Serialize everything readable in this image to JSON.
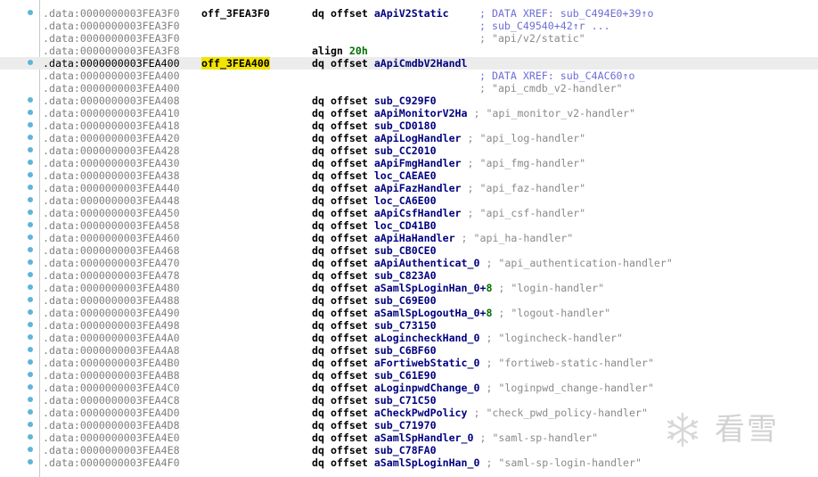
{
  "rows": [
    {
      "addr": ".data:0000000003FEA3F0",
      "label": "off_3FEA3F0",
      "mn": "dq offset",
      "op": "aApiV2Static",
      "cmt": "",
      "xref": "; DATA XREF: sub_C494E0+39↑o",
      "dot": true
    },
    {
      "addr": ".data:0000000003FEA3F0",
      "label": "",
      "mn": "",
      "op": "",
      "cmt": "",
      "xref": "; sub_C49540+42↑r ...",
      "dot": false
    },
    {
      "addr": ".data:0000000003FEA3F0",
      "label": "",
      "mn": "",
      "op": "",
      "cmt": "",
      "xref": "",
      "rcmt": "; \"api/v2/static\"",
      "dot": false
    },
    {
      "addr": ".data:0000000003FEA3F8",
      "label": "",
      "mn": "align",
      "op": "",
      "num": "20h",
      "cmt": "",
      "xref": "",
      "dot": false
    },
    {
      "addr": ".data:0000000003FEA400",
      "label": "off_3FEA400",
      "mn": "dq offset",
      "op": "aApiCmdbV2Handl",
      "cmt": "",
      "xref": "",
      "dot": true,
      "highlight": true
    },
    {
      "addr": ".data:0000000003FEA400",
      "label": "",
      "mn": "",
      "op": "",
      "cmt": "",
      "xref": "; DATA XREF: sub_C4AC60↑o",
      "dot": false
    },
    {
      "addr": ".data:0000000003FEA400",
      "label": "",
      "mn": "",
      "op": "",
      "cmt": "",
      "xref": "",
      "rcmt": "; \"api_cmdb_v2-handler\"",
      "dot": false
    },
    {
      "addr": ".data:0000000003FEA408",
      "label": "",
      "mn": "dq offset",
      "op": "sub_C929F0",
      "cmt": "",
      "xref": "",
      "dot": true
    },
    {
      "addr": ".data:0000000003FEA410",
      "label": "",
      "mn": "dq offset",
      "op": "aApiMonitorV2Ha",
      "cmt": " ; \"api_monitor_v2-handler\"",
      "xref": "",
      "dot": true
    },
    {
      "addr": ".data:0000000003FEA418",
      "label": "",
      "mn": "dq offset",
      "op": "sub_CD0180",
      "cmt": "",
      "xref": "",
      "dot": true
    },
    {
      "addr": ".data:0000000003FEA420",
      "label": "",
      "mn": "dq offset",
      "op": "aApiLogHandler",
      "cmt": " ; \"api_log-handler\"",
      "xref": "",
      "dot": true
    },
    {
      "addr": ".data:0000000003FEA428",
      "label": "",
      "mn": "dq offset",
      "op": "sub_CC2010",
      "cmt": "",
      "xref": "",
      "dot": true
    },
    {
      "addr": ".data:0000000003FEA430",
      "label": "",
      "mn": "dq offset",
      "op": "aApiFmgHandler",
      "cmt": " ; \"api_fmg-handler\"",
      "xref": "",
      "dot": true
    },
    {
      "addr": ".data:0000000003FEA438",
      "label": "",
      "mn": "dq offset",
      "op": "loc_CAEAE0",
      "cmt": "",
      "xref": "",
      "dot": true
    },
    {
      "addr": ".data:0000000003FEA440",
      "label": "",
      "mn": "dq offset",
      "op": "aApiFazHandler",
      "cmt": " ; \"api_faz-handler\"",
      "xref": "",
      "dot": true
    },
    {
      "addr": ".data:0000000003FEA448",
      "label": "",
      "mn": "dq offset",
      "op": "loc_CA6E00",
      "cmt": "",
      "xref": "",
      "dot": true
    },
    {
      "addr": ".data:0000000003FEA450",
      "label": "",
      "mn": "dq offset",
      "op": "aApiCsfHandler",
      "cmt": " ; \"api_csf-handler\"",
      "xref": "",
      "dot": true
    },
    {
      "addr": ".data:0000000003FEA458",
      "label": "",
      "mn": "dq offset",
      "op": "loc_CD41B0",
      "cmt": "",
      "xref": "",
      "dot": true
    },
    {
      "addr": ".data:0000000003FEA460",
      "label": "",
      "mn": "dq offset",
      "op": "aApiHaHandler",
      "cmt": " ; \"api_ha-handler\"",
      "xref": "",
      "dot": true
    },
    {
      "addr": ".data:0000000003FEA468",
      "label": "",
      "mn": "dq offset",
      "op": "sub_CB0CE0",
      "cmt": "",
      "xref": "",
      "dot": true
    },
    {
      "addr": ".data:0000000003FEA470",
      "label": "",
      "mn": "dq offset",
      "op": "aApiAuthenticat_0",
      "cmt": " ; \"api_authentication-handler\"",
      "xref": "",
      "dot": true
    },
    {
      "addr": ".data:0000000003FEA478",
      "label": "",
      "mn": "dq offset",
      "op": "sub_C823A0",
      "cmt": "",
      "xref": "",
      "dot": true
    },
    {
      "addr": ".data:0000000003FEA480",
      "label": "",
      "mn": "dq offset",
      "op": "aSamlSpLoginHan_0+",
      "num": "8",
      "cmt": " ; \"login-handler\"",
      "xref": "",
      "dot": true
    },
    {
      "addr": ".data:0000000003FEA488",
      "label": "",
      "mn": "dq offset",
      "op": "sub_C69E00",
      "cmt": "",
      "xref": "",
      "dot": true
    },
    {
      "addr": ".data:0000000003FEA490",
      "label": "",
      "mn": "dq offset",
      "op": "aSamlSpLogoutHa_0+",
      "num": "8",
      "cmt": " ; \"logout-handler\"",
      "xref": "",
      "dot": true
    },
    {
      "addr": ".data:0000000003FEA498",
      "label": "",
      "mn": "dq offset",
      "op": "sub_C73150",
      "cmt": "",
      "xref": "",
      "dot": true
    },
    {
      "addr": ".data:0000000003FEA4A0",
      "label": "",
      "mn": "dq offset",
      "op": "aLogincheckHand_0",
      "cmt": " ; \"logincheck-handler\"",
      "xref": "",
      "dot": true
    },
    {
      "addr": ".data:0000000003FEA4A8",
      "label": "",
      "mn": "dq offset",
      "op": "sub_C6BF60",
      "cmt": "",
      "xref": "",
      "dot": true
    },
    {
      "addr": ".data:0000000003FEA4B0",
      "label": "",
      "mn": "dq offset",
      "op": "aFortiwebStatic_0",
      "cmt": " ; \"fortiweb-static-handler\"",
      "xref": "",
      "dot": true
    },
    {
      "addr": ".data:0000000003FEA4B8",
      "label": "",
      "mn": "dq offset",
      "op": "sub_C61E90",
      "cmt": "",
      "xref": "",
      "dot": true
    },
    {
      "addr": ".data:0000000003FEA4C0",
      "label": "",
      "mn": "dq offset",
      "op": "aLoginpwdChange_0",
      "cmt": " ; \"loginpwd_change-handler\"",
      "xref": "",
      "dot": true
    },
    {
      "addr": ".data:0000000003FEA4C8",
      "label": "",
      "mn": "dq offset",
      "op": "sub_C71C50",
      "cmt": "",
      "xref": "",
      "dot": true
    },
    {
      "addr": ".data:0000000003FEA4D0",
      "label": "",
      "mn": "dq offset",
      "op": "aCheckPwdPolicy",
      "cmt": " ; \"check_pwd_policy-handler\"",
      "xref": "",
      "dot": true
    },
    {
      "addr": ".data:0000000003FEA4D8",
      "label": "",
      "mn": "dq offset",
      "op": "sub_C71970",
      "cmt": "",
      "xref": "",
      "dot": true
    },
    {
      "addr": ".data:0000000003FEA4E0",
      "label": "",
      "mn": "dq offset",
      "op": "aSamlSpHandler_0",
      "cmt": " ; \"saml-sp-handler\"",
      "xref": "",
      "dot": true
    },
    {
      "addr": ".data:0000000003FEA4E8",
      "label": "",
      "mn": "dq offset",
      "op": "sub_C78FA0",
      "cmt": "",
      "xref": "",
      "dot": true
    },
    {
      "addr": ".data:0000000003FEA4F0",
      "label": "",
      "mn": "dq offset",
      "op": "aSamlSpLoginHan_0",
      "cmt": " ; \"saml-sp-login-handler\"",
      "xref": "",
      "dot": true
    }
  ],
  "watermark": {
    "text": "看雪",
    "icon": "snowflake-logo-icon"
  },
  "colors": {
    "address": "#808080",
    "label": "#000000",
    "highlight_label": "#f2e400",
    "operand": "#000080",
    "comment": "#8a8a8a",
    "xref": "#6d6dd6",
    "number": "#007000",
    "dot": "#5fb4d8"
  }
}
